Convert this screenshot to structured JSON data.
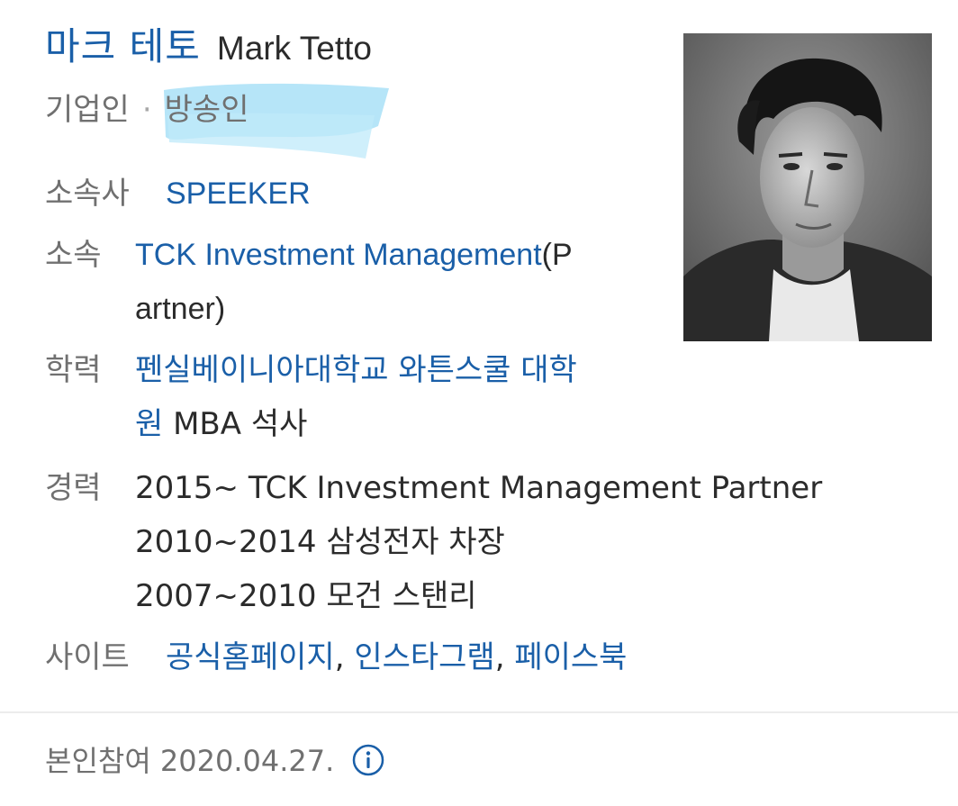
{
  "profile": {
    "name_ko": "마크 테토",
    "name_en": "Mark Tetto",
    "occupation_1": "기업인",
    "occupation_separator": "·",
    "occupation_2": "방송인"
  },
  "details": {
    "agency": {
      "label": "소속사",
      "value": "SPEEKER"
    },
    "affiliation": {
      "label": "소속",
      "value_link_line1": "TCK Investment Management",
      "value_suffix_line1": "(P",
      "value_line2": "artner)"
    },
    "education": {
      "label": "학력",
      "value_link_line1": "펜실베이니아대학교 와튼스쿨 대학",
      "value_link_line2": "원",
      "value_suffix_line2": " MBA 석사"
    },
    "career": {
      "label": "경력",
      "items": [
        "2015~ TCK Investment Management Partner",
        "2010~2014 삼성전자 차장",
        "2007~2010 모건 스탠리"
      ]
    },
    "sites": {
      "label": "사이트",
      "links": [
        "공식홈페이지",
        "인스타그램",
        "페이스북"
      ],
      "separator": ","
    }
  },
  "footer": {
    "participation": "본인참여 2020.04.27."
  },
  "icons": {
    "info": "info-icon",
    "photo": "profile-photo"
  },
  "colors": {
    "link": "#1a5fa8",
    "label": "#707070",
    "text": "#2b2b2b",
    "highlight": "#9fdcf5"
  }
}
